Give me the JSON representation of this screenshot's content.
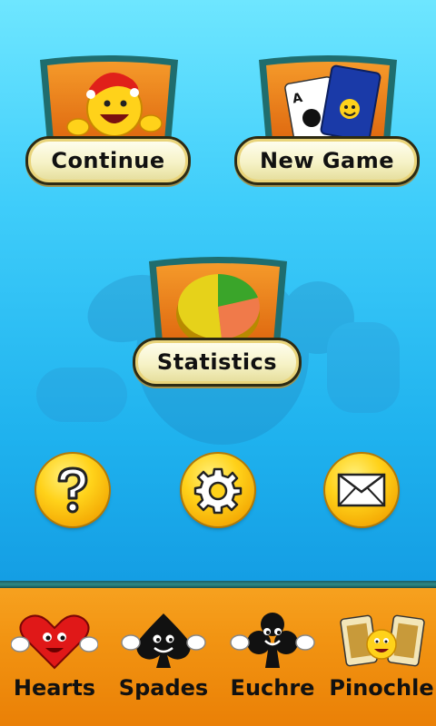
{
  "menu": {
    "continue_label": "Continue",
    "new_game_label": "New Game",
    "statistics_label": "Statistics"
  },
  "round_buttons": {
    "help_icon": "question-icon",
    "settings_icon": "gear-icon",
    "mail_icon": "envelope-icon"
  },
  "games": [
    {
      "label": "Hearts",
      "icon": "heart-mascot-icon"
    },
    {
      "label": "Spades",
      "icon": "spade-mascot-icon"
    },
    {
      "label": "Euchre",
      "icon": "club-mascot-icon"
    },
    {
      "label": "Pinochle",
      "icon": "face-cards-icon"
    }
  ],
  "colors": {
    "sky_top": "#6ee6ff",
    "sky_bottom": "#149ee4",
    "bar_orange": "#f29412",
    "tile_orange": "#e8700f",
    "pill_cream": "#f6f2c6",
    "gold": "#ffd21a"
  }
}
